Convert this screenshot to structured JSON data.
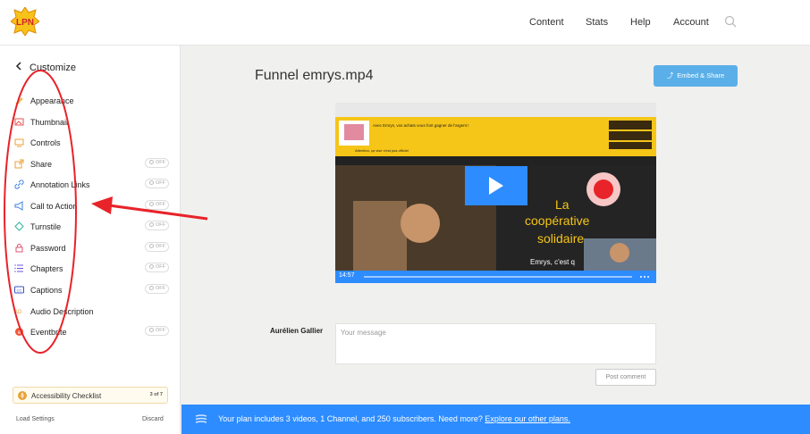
{
  "header": {
    "nav": [
      "Content",
      "Stats",
      "Help",
      "Account"
    ],
    "logo_text": "LPN"
  },
  "sidebar": {
    "back_label": "Customize",
    "items": [
      {
        "label": "Appearance",
        "icon": "paint-icon",
        "toggle": null
      },
      {
        "label": "Thumbnail",
        "icon": "image-icon",
        "toggle": null
      },
      {
        "label": "Controls",
        "icon": "monitor-icon",
        "toggle": null
      },
      {
        "label": "Share",
        "icon": "share-icon",
        "toggle": "OFF"
      },
      {
        "label": "Annotation Links",
        "icon": "link-icon",
        "toggle": "OFF"
      },
      {
        "label": "Call to Action",
        "icon": "megaphone-icon",
        "toggle": "OFF"
      },
      {
        "label": "Turnstile",
        "icon": "diamond-icon",
        "toggle": "OFF"
      },
      {
        "label": "Password",
        "icon": "lock-icon",
        "toggle": "OFF"
      },
      {
        "label": "Chapters",
        "icon": "list-icon",
        "toggle": "OFF"
      },
      {
        "label": "Captions",
        "icon": "cc-icon",
        "toggle": "OFF"
      },
      {
        "label": "Audio Description",
        "icon": "audio-icon",
        "toggle": null
      },
      {
        "label": "Eventbrite",
        "icon": "eventbrite-icon",
        "toggle": "OFF"
      }
    ],
    "checklist": {
      "label": "Accessibility Checklist",
      "count": "3 of 7"
    },
    "load_settings": "Load Settings",
    "discard": "Discard"
  },
  "main": {
    "title": "Funnel emrys.mp4",
    "embed_label": "Embed & Share",
    "video": {
      "time": "14:57",
      "slide_line1": "La",
      "slide_line2": "coopérative",
      "slide_line3": "solidaire",
      "slide_line4": "Emrys, c'est q",
      "site_headline": "Avec Emrys, vos achats vous font gagner de l'argent !",
      "site_subline": "Attention, ça vise n'est pas officiel"
    },
    "comment": {
      "author": "Aurélien Gallier",
      "placeholder": "Your message",
      "post_label": "Post comment"
    }
  },
  "banner": {
    "text": "Your plan includes 3 videos, 1 Channel, and 250 subscribers. Need more? ",
    "link": "Explore our other plans."
  },
  "colors": {
    "accent": "#2d8cff",
    "embed": "#5aafe8",
    "annotation": "#e8232a",
    "site_yellow": "#f5c518"
  }
}
